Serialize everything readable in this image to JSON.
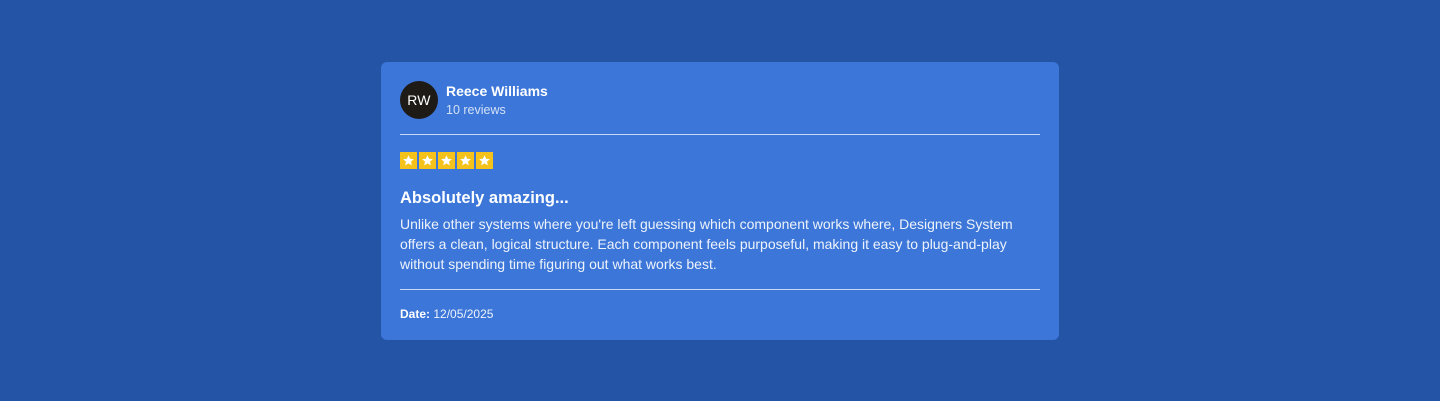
{
  "review": {
    "author": {
      "initials": "RW",
      "name": "Reece Williams",
      "review_count": "10 reviews"
    },
    "rating": 5,
    "rating_max": 5,
    "title": "Absolutely amazing...",
    "body": "Unlike other systems where you're left guessing which component works where, Designers System offers a clean, logical structure. Each component feels purposeful, making it easy to plug-and-play without spending time figuring out what works best.",
    "date_label": "Date:",
    "date_value": "12/05/2025"
  },
  "colors": {
    "background": "#2354a6",
    "card": "#3b76d8",
    "avatar": "#1e1a16",
    "star": "#f4c21b"
  },
  "icons": {
    "star": "star-icon"
  }
}
